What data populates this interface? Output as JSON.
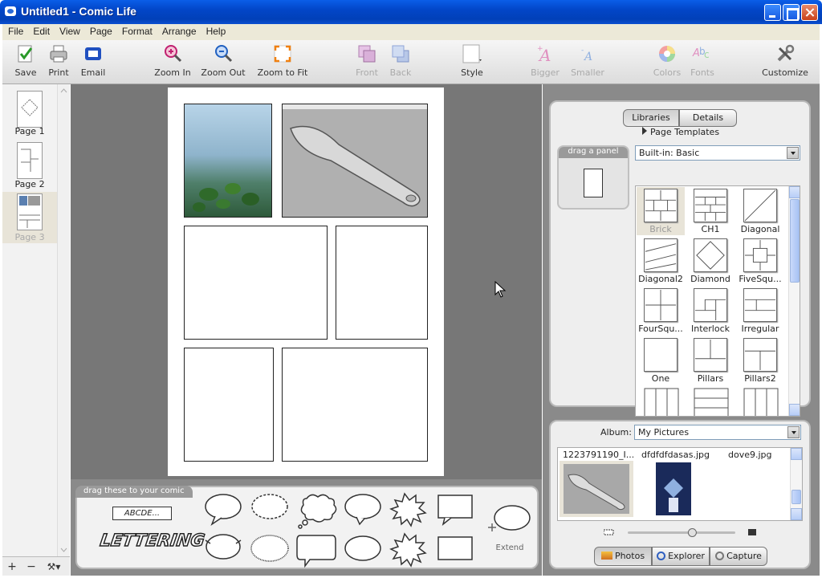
{
  "window": {
    "title": "Untitled1 - Comic Life"
  },
  "menu": [
    "File",
    "Edit",
    "View",
    "Page",
    "Format",
    "Arrange",
    "Help"
  ],
  "toolbar": {
    "save": "Save",
    "print": "Print",
    "email": "Email",
    "zoom_in": "Zoom In",
    "zoom_out": "Zoom Out",
    "zoom_fit": "Zoom to Fit",
    "front": "Front",
    "back": "Back",
    "style": "Style",
    "bigger": "Bigger",
    "smaller": "Smaller",
    "colors": "Colors",
    "fonts": "Fonts",
    "customize": "Customize"
  },
  "pages": [
    {
      "label": "Page 1"
    },
    {
      "label": "Page 2"
    },
    {
      "label": "Page 3"
    }
  ],
  "strip_buttons": {
    "add": "+",
    "remove": "−",
    "tools": "⚒▾"
  },
  "tray": {
    "tab": "drag these to your comic",
    "lettering_box": "ABCDE...",
    "lettering_word": "LETTERING",
    "extend": "Extend"
  },
  "library": {
    "tabs": [
      "Libraries",
      "Details"
    ],
    "section": "Page Templates",
    "drag_panel": "drag a panel",
    "template_set": "Built-in: Basic",
    "templates": [
      "Brick",
      "CH1",
      "Diagonal",
      "Diagonal2",
      "Diamond",
      "FiveSqu...",
      "FourSqu...",
      "Interlock",
      "Irregular",
      "One",
      "Pillars",
      "Pillars2"
    ]
  },
  "photos": {
    "album_label": "Album:",
    "album": "My Pictures",
    "files": [
      "1223791190_I...",
      "dfdfdfdasas.jpg",
      "dove9.jpg"
    ],
    "tabs": [
      "Photos",
      "Explorer",
      "Capture"
    ],
    "zoom_level": 0.6
  },
  "colors": {
    "titlebar": "#0246c8",
    "canvas": "#777777",
    "accent_selected": "#e8e4d8"
  }
}
